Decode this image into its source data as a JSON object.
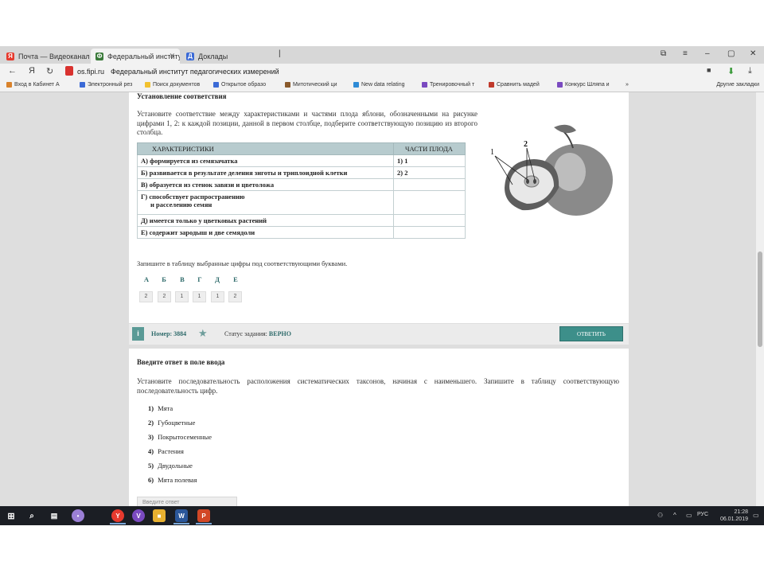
{
  "browser": {
    "tabs": [
      {
        "label": "Почта — Видеоканалы",
        "fav_color": "#e63a2e",
        "fav_char": "Я"
      },
      {
        "label": "Федеральный институт",
        "fav_color": "#3a7a3a",
        "fav_char": "Ф"
      },
      {
        "label": "Доклады",
        "fav_color": "#3b6ad6",
        "fav_char": "Д"
      }
    ],
    "url": "os.fipi.ru",
    "page_title": "Федеральный институт педагогических измерений",
    "bookmarks": [
      {
        "label": "Вход в Кабинет А",
        "color": "#d9822b"
      },
      {
        "label": "Электронный рез",
        "color": "#3b6ad6"
      },
      {
        "label": "Поиск документов",
        "color": "#f2c12e"
      },
      {
        "label": "Открытое образо",
        "color": "#3b6ad6"
      },
      {
        "label": "Митотический ци",
        "color": "#8a5a2b"
      },
      {
        "label": "New data relating",
        "color": "#2e8bd6"
      },
      {
        "label": "Тренировочный т",
        "color": "#7a4ac0"
      },
      {
        "label": "Сравнить мадей",
        "color": "#c0392b"
      },
      {
        "label": "Конкурс Шляпа и",
        "color": "#7a4ac0"
      }
    ],
    "other_bookmarks": "Другие закладки"
  },
  "task1": {
    "title": "Установление соответствия",
    "text": "Установите соответствие между характеристиками и частями плода яблони, обозначенными на рисунке цифрами 1, 2: к каждой позиции, данной в первом столбце, подберите соответствующую позицию из второго столбца.",
    "col_characteristics": "ХАРАКТЕРИСТИКИ",
    "col_parts": "ЧАСТИ ПЛОДА",
    "rows": [
      {
        "text": "А) формируется из семязачатка",
        "ans": "1) 1"
      },
      {
        "text": "Б) развивается в результате деления зиготы и триплоидной клетки",
        "ans": "2) 2"
      },
      {
        "text": "В) образуется из стенок завязи и цветоложа",
        "ans": ""
      },
      {
        "text": "Г) способствует распространению",
        "text2": "и расселению семян",
        "ans": ""
      },
      {
        "text": "Д) имеется только у цветковых растений",
        "ans": ""
      },
      {
        "text": "Е) содержит зародыш и две семядоли",
        "ans": ""
      }
    ],
    "figure_label_1": "1",
    "figure_label_2": "2",
    "instruction": "Запишите в таблицу выбранные цифры под соответствующими буквами.",
    "letters": [
      "А",
      "Б",
      "В",
      "Г",
      "Д",
      "Е"
    ],
    "answers": [
      "2",
      "2",
      "1",
      "1",
      "1",
      "2"
    ],
    "info_icon": "i",
    "number_label": "Номер: 3884",
    "status_label": "Статус задания:",
    "status_value": "ВЕРНО",
    "answer_button": "ОТВЕТИТЬ"
  },
  "task2": {
    "title": "Введите ответ в поле ввода",
    "text": "Установите последовательность расположения систематических таксонов, начиная с наименьшего. Запишите в таблицу соответствующую последовательность цифр.",
    "items": [
      {
        "num": "1)",
        "label": "Мята"
      },
      {
        "num": "2)",
        "label": "Губоцветные"
      },
      {
        "num": "3)",
        "label": "Покрытосеменные"
      },
      {
        "num": "4)",
        "label": "Растения"
      },
      {
        "num": "5)",
        "label": "Двудольные"
      },
      {
        "num": "6)",
        "label": "Мята полевая"
      }
    ],
    "input_placeholder": "Введите ответ"
  },
  "taskbar": {
    "lang": "РУС",
    "time": "21:28",
    "date": "06.01.2019",
    "apps": [
      {
        "name": "yandex-browser",
        "color": "#e63a2e",
        "char": "Y"
      },
      {
        "name": "viber",
        "color": "#7a4ac0",
        "char": "V"
      },
      {
        "name": "explorer",
        "color": "#e8b130",
        "char": "■"
      },
      {
        "name": "file-explorer",
        "color": "#d9a02b",
        "char": "■"
      },
      {
        "name": "word",
        "color": "#2b579a",
        "char": "W"
      },
      {
        "name": "powerpoint",
        "color": "#d24726",
        "char": "P"
      }
    ]
  }
}
